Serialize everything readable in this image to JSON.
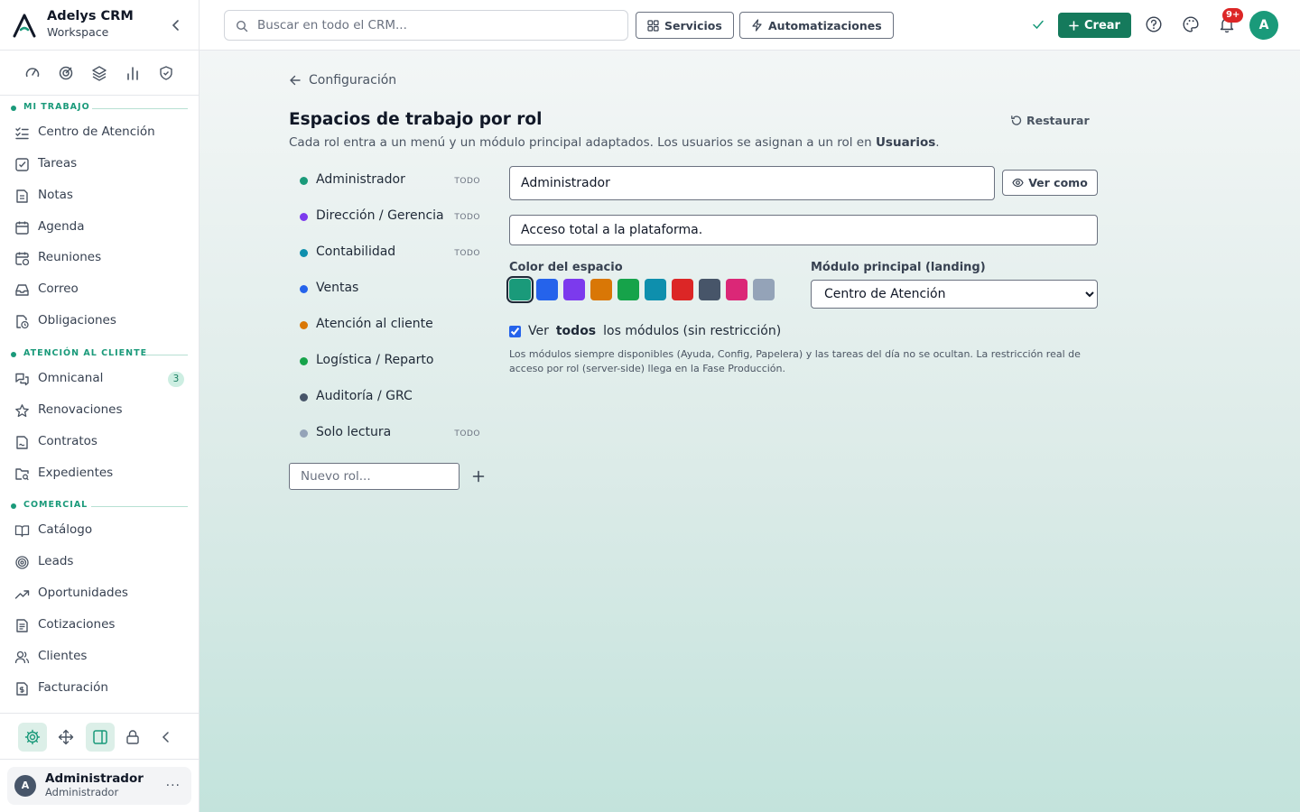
{
  "brand": {
    "title": "Adelys CRM",
    "subtitle": "Workspace"
  },
  "sidebar": {
    "quick_icons": [
      "gauge-icon",
      "target-icon",
      "layers-icon",
      "bar-chart-icon",
      "shield-check-icon"
    ],
    "sections": [
      {
        "label": "MI TRABAJO",
        "items": [
          {
            "label": "Centro de Atención",
            "icon": "list-check-icon"
          },
          {
            "label": "Tareas",
            "icon": "checkbox-icon"
          },
          {
            "label": "Notas",
            "icon": "note-icon"
          },
          {
            "label": "Agenda",
            "icon": "calendar-icon"
          },
          {
            "label": "Reuniones",
            "icon": "calendar-clock-icon"
          },
          {
            "label": "Correo",
            "icon": "inbox-icon"
          },
          {
            "label": "Obligaciones",
            "icon": "file-clock-icon"
          }
        ]
      },
      {
        "label": "ATENCIÓN AL CLIENTE",
        "items": [
          {
            "label": "Omnicanal",
            "icon": "messages-icon",
            "badge": "3"
          },
          {
            "label": "Renovaciones",
            "icon": "star-icon"
          },
          {
            "label": "Contratos",
            "icon": "contract-icon"
          },
          {
            "label": "Expedientes",
            "icon": "folder-search-icon"
          }
        ]
      },
      {
        "label": "COMERCIAL",
        "items": [
          {
            "label": "Catálogo",
            "icon": "book-open-icon"
          },
          {
            "label": "Leads",
            "icon": "target-icon"
          },
          {
            "label": "Oportunidades",
            "icon": "trending-up-icon"
          },
          {
            "label": "Cotizaciones",
            "icon": "file-text-icon"
          },
          {
            "label": "Clientes",
            "icon": "users-icon"
          },
          {
            "label": "Facturación",
            "icon": "invoice-icon"
          }
        ]
      }
    ],
    "bottom_icons": [
      "settings-icon",
      "move-icon",
      "panel-icon",
      "lock-icon",
      "chevron-left-icon"
    ],
    "user": {
      "initial": "A",
      "name": "Administrador",
      "role": "Administrador",
      "more": "···"
    }
  },
  "topbar": {
    "search_placeholder": "Buscar en todo el CRM...",
    "services_label": "Servicios",
    "automations_label": "Automatizaciones",
    "create_label": "Crear",
    "notifications_badge": "9+",
    "avatar_initial": "A"
  },
  "page": {
    "back_label": "Configuración",
    "title": "Espacios de trabajo por rol",
    "description_prefix": "Cada rol entra a un menú y un módulo principal adaptados. Los usuarios se asignan a un rol en ",
    "description_link": "Usuarios",
    "description_suffix": ".",
    "restore_label": "Restaurar",
    "roles": [
      {
        "name": "Administrador",
        "color": "#1a9a7a",
        "tag": "TODO",
        "selected": true
      },
      {
        "name": "Dirección / Gerencia",
        "color": "#7c3aed",
        "tag": "TODO"
      },
      {
        "name": "Contabilidad",
        "color": "#0e8fad",
        "tag": "TODO"
      },
      {
        "name": "Ventas",
        "color": "#2563eb",
        "tag": ""
      },
      {
        "name": "Atención al cliente",
        "color": "#d97706",
        "tag": ""
      },
      {
        "name": "Logística / Reparto",
        "color": "#16a34a",
        "tag": ""
      },
      {
        "name": "Auditoría / GRC",
        "color": "#475569",
        "tag": ""
      },
      {
        "name": "Solo lectura",
        "color": "#94a3b8",
        "tag": "TODO"
      }
    ],
    "new_role_placeholder": "Nuevo rol...",
    "role_name_value": "Administrador",
    "see_as_label": "Ver como",
    "role_desc_value": "Acceso total a la plataforma.",
    "color_label": "Color del espacio",
    "colors": [
      "#1a9a7a",
      "#2563eb",
      "#7c3aed",
      "#d97706",
      "#16a34a",
      "#0e8fad",
      "#dc2626",
      "#475569",
      "#db2777",
      "#94a3b8"
    ],
    "landing_label": "Módulo principal (landing)",
    "landing_value": "Centro de Atención",
    "all_modules_prefix": "Ver",
    "all_modules_bold": "todos",
    "all_modules_suffix": "los módulos (sin restricción)",
    "all_modules_checked": true,
    "note": "Los módulos siempre disponibles (Ayuda, Config, Papelera) y las tareas del día no se ocultan. La restricción real de acceso por rol (server-side) llega en la Fase Producción."
  },
  "colors": {
    "accent": "#1a9a7a",
    "primary_button": "#157a5c",
    "badge_red": "#dc2626"
  }
}
